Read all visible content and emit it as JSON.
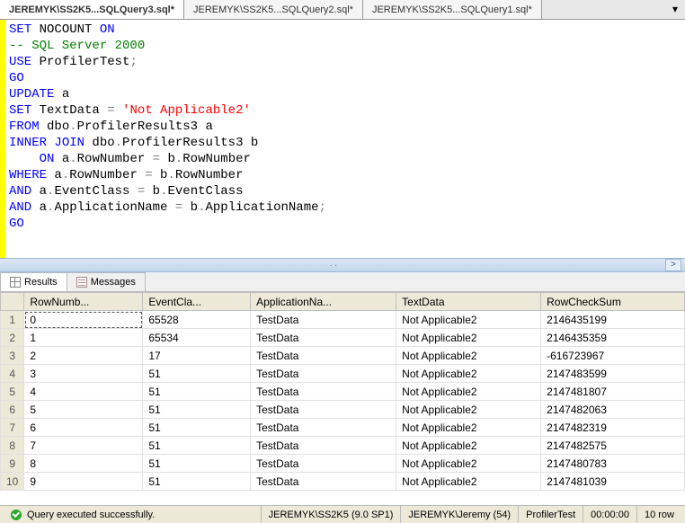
{
  "tabs": [
    {
      "label": "JEREMYK\\SS2K5...SQLQuery3.sql*",
      "active": true
    },
    {
      "label": "JEREMYK\\SS2K5...SQLQuery2.sql*",
      "active": false
    },
    {
      "label": "JEREMYK\\SS2K5...SQLQuery1.sql*",
      "active": false
    }
  ],
  "sql": {
    "l1a": "SET",
    "l1b": " NOCOUNT ",
    "l1c": "ON",
    "l2": "-- SQL Server 2000",
    "l3a": "USE",
    "l3b": " ProfilerTest",
    "l3c": ";",
    "l4": "GO",
    "l5a": "UPDATE",
    "l5b": " a",
    "l6a": "SET",
    "l6b": " TextData ",
    "l6c": "=",
    "l6d": " ",
    "l6e": "'Not Applicable2'",
    "l7a": "FROM",
    "l7b": " dbo",
    "l7c": ".",
    "l7d": "ProfilerResults3 a",
    "l8a": "INNER",
    "l8b": " ",
    "l8c": "JOIN",
    "l8d": " dbo",
    "l8e": ".",
    "l8f": "ProfilerResults3 b",
    "l9a": "    ",
    "l9b": "ON",
    "l9c": " a",
    "l9d": ".",
    "l9e": "RowNumber ",
    "l9f": "=",
    "l9g": " b",
    "l9h": ".",
    "l9i": "RowNumber",
    "l10a": "WHERE",
    "l10b": " a",
    "l10c": ".",
    "l10d": "RowNumber ",
    "l10e": "=",
    "l10f": " b",
    "l10g": ".",
    "l10h": "RowNumber",
    "l11a": "AND",
    "l11b": " a",
    "l11c": ".",
    "l11d": "EventClass ",
    "l11e": "=",
    "l11f": " b",
    "l11g": ".",
    "l11h": "EventClass",
    "l12a": "AND",
    "l12b": " a",
    "l12c": ".",
    "l12d": "ApplicationName ",
    "l12e": "=",
    "l12f": " b",
    "l12g": ".",
    "l12h": "ApplicationName",
    "l12i": ";",
    "l13": "GO"
  },
  "resultTabs": {
    "results": "Results",
    "messages": "Messages"
  },
  "grid": {
    "headers": [
      "RowNumb...",
      "EventCla...",
      "ApplicationNa...",
      "TextData",
      "RowCheckSum"
    ],
    "rows": [
      {
        "n": "1",
        "c": [
          "0",
          "65528",
          "TestData",
          "Not Applicable2",
          "2146435199"
        ]
      },
      {
        "n": "2",
        "c": [
          "1",
          "65534",
          "TestData",
          "Not Applicable2",
          "2146435359"
        ]
      },
      {
        "n": "3",
        "c": [
          "2",
          "17",
          "TestData",
          "Not Applicable2",
          "-616723967"
        ]
      },
      {
        "n": "4",
        "c": [
          "3",
          "51",
          "TestData",
          "Not Applicable2",
          "2147483599"
        ]
      },
      {
        "n": "5",
        "c": [
          "4",
          "51",
          "TestData",
          "Not Applicable2",
          "2147481807"
        ]
      },
      {
        "n": "6",
        "c": [
          "5",
          "51",
          "TestData",
          "Not Applicable2",
          "2147482063"
        ]
      },
      {
        "n": "7",
        "c": [
          "6",
          "51",
          "TestData",
          "Not Applicable2",
          "2147482319"
        ]
      },
      {
        "n": "8",
        "c": [
          "7",
          "51",
          "TestData",
          "Not Applicable2",
          "2147482575"
        ]
      },
      {
        "n": "9",
        "c": [
          "8",
          "51",
          "TestData",
          "Not Applicable2",
          "2147480783"
        ]
      },
      {
        "n": "10",
        "c": [
          "9",
          "51",
          "TestData",
          "Not Applicable2",
          "2147481039"
        ]
      }
    ]
  },
  "status": {
    "msg": "Query executed successfully.",
    "server": "JEREMYK\\SS2K5 (9.0 SP1)",
    "user": "JEREMYK\\Jeremy (54)",
    "db": "ProfilerTest",
    "time": "00:00:00",
    "rows": "10 row"
  },
  "glyphs": {
    "overflow": "▾",
    "scrollRight": ">"
  }
}
